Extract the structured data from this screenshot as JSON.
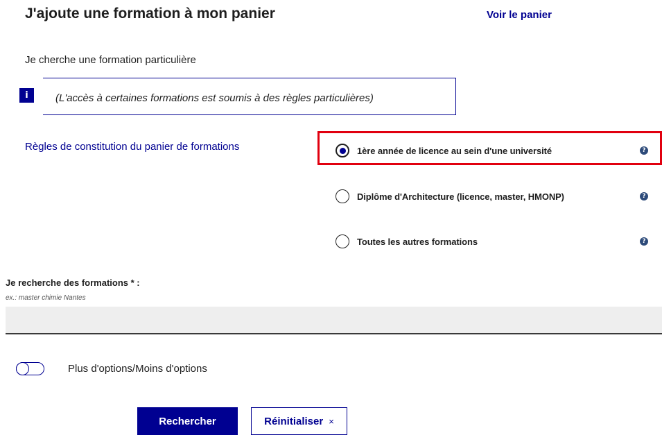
{
  "header": {
    "title": "J'ajoute une formation à mon panier",
    "cart_link": "Voir le panier"
  },
  "search_section": {
    "heading": "Je cherche une formation particulière",
    "info_icon": "i",
    "info_text": "(L'accès à certaines formations est soumis à des règles particulières)",
    "rules_link": "Règles de constitution du panier de formations"
  },
  "formation_types": {
    "options": [
      {
        "label": "1ère année de licence au sein d'une université",
        "checked": true
      },
      {
        "label": "Diplôme d'Architecture (licence, master, HMONP)",
        "checked": false
      },
      {
        "label": "Toutes les autres formations",
        "checked": false
      }
    ],
    "help_icon": "?"
  },
  "search_field": {
    "label": "Je recherche des formations * :",
    "hint": "ex.: master chimie Nantes",
    "value": "",
    "placeholder": ""
  },
  "options_toggle": {
    "label": "Plus d'options/Moins d'options",
    "on": false
  },
  "actions": {
    "search_label": "Rechercher",
    "reset_label": "Réinitialiser",
    "reset_icon": "×"
  },
  "colors": {
    "primary": "#000091",
    "highlight": "#e1000f"
  }
}
